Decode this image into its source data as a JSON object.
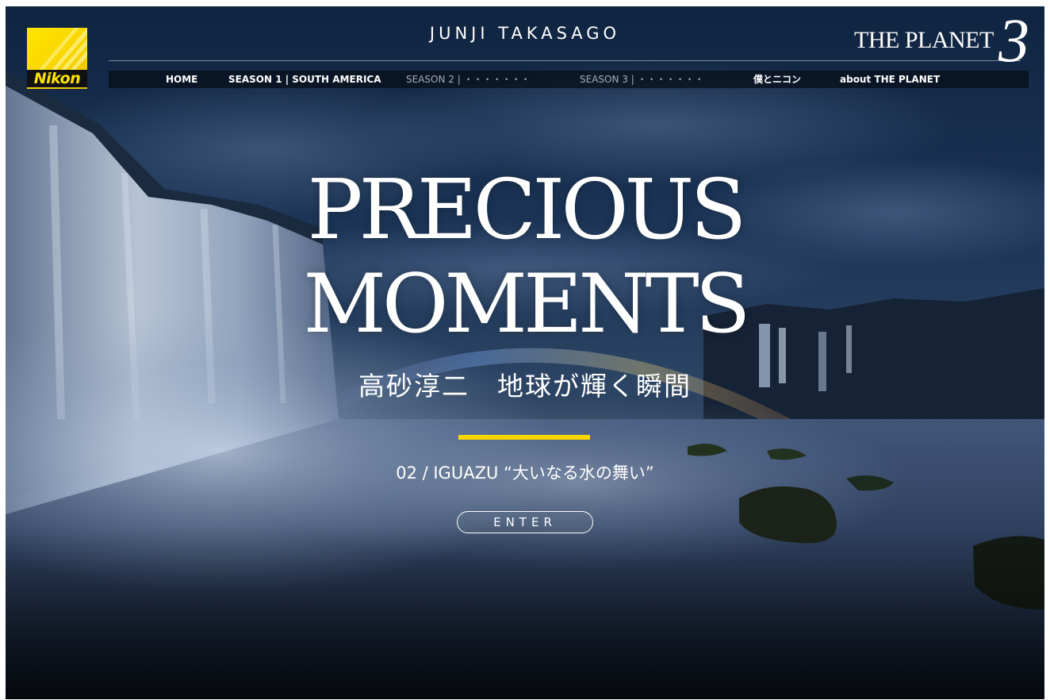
{
  "header": {
    "logo_text": "Nikon",
    "author": "JUNJI TAKASAGO",
    "brand": "THE PLANET",
    "brand_number": "3"
  },
  "nav": [
    {
      "label": "HOME",
      "state": "active"
    },
    {
      "label": "SEASON 1 | SOUTH AMERICA",
      "state": "active"
    },
    {
      "label": "SEASON 2 | ・・・・・・・",
      "state": "dim"
    },
    {
      "label": "SEASON 3 | ・・・・・・・",
      "state": "dim"
    },
    {
      "label": "僕とニコン",
      "state": "active"
    },
    {
      "label": "about THE PLANET",
      "state": "active"
    }
  ],
  "hero": {
    "title_line1": "PRECIOUS",
    "title_line2": "MOMENTS",
    "subtitle": "高砂淳二　地球が輝く瞬間",
    "episode": "02 / IGUAZU “大いなる水の舞い”",
    "enter_label": "ENTER"
  },
  "colors": {
    "accent": "#ffd500",
    "logo_yellow": "#ffe600",
    "night_sky": "#1a2f4c"
  },
  "icons": [
    "nikon-logo",
    "waterfall-photo"
  ]
}
